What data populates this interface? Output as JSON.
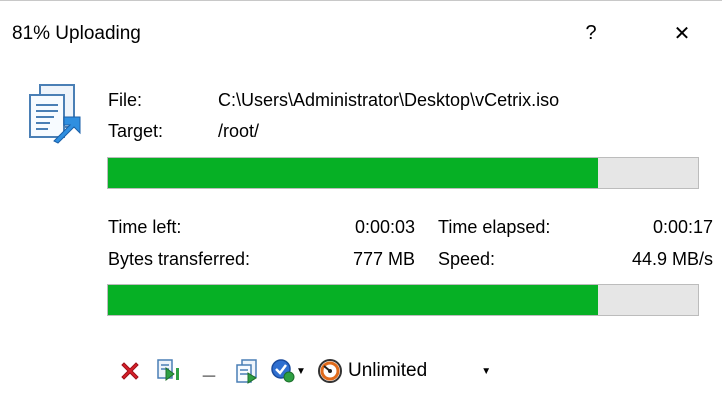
{
  "window": {
    "title": "81% Uploading",
    "help_label": "?",
    "close_label": "✕"
  },
  "transfer": {
    "file_label": "File:",
    "file_value": "C:\\Users\\Administrator\\Desktop\\vCetrix.iso",
    "target_label": "Target:",
    "target_value": "/root/",
    "file_progress": 0.83,
    "total_progress": 0.83
  },
  "stats": {
    "time_left_label": "Time left:",
    "time_left_value": "0:00:03",
    "time_elapsed_label": "Time elapsed:",
    "time_elapsed_value": "0:00:17",
    "bytes_label": "Bytes transferred:",
    "bytes_value": "777 MB",
    "speed_label": "Speed:",
    "speed_value": "44.9 MB/s"
  },
  "toolbar": {
    "speed_limit": "Unlimited",
    "minimize_label": "_",
    "items": [
      "cancel-icon",
      "transfer-in-background-icon",
      "minimize-icon",
      "queue-icon",
      "after-completion-icon",
      "speed-limit-icon"
    ]
  },
  "colors": {
    "progress_fill": "#06b025",
    "progress_track": "#e6e6e6",
    "cancel_red": "#d9202a"
  }
}
